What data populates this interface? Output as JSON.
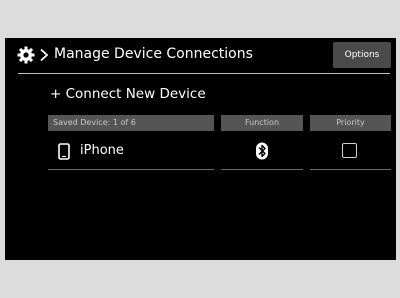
{
  "header": {
    "title": "Manage Device Connections",
    "options_label": "Options",
    "back_icon": "chevron-right-icon",
    "settings_icon": "gear-icon"
  },
  "connect_label": "+ Connect New Device",
  "columns": {
    "saved": "Saved Device: 1 of 6",
    "function": "Function",
    "priority": "Priority"
  },
  "devices": [
    {
      "name": "iPhone",
      "icon": "phone-icon",
      "function_icon": "bluetooth-icon",
      "priority_checked": false
    }
  ],
  "colors": {
    "screen_bg": "#000000",
    "header_button_bg": "#4a4a4a",
    "column_header_bg": "#555555",
    "bezel": "#dcdcdc"
  }
}
